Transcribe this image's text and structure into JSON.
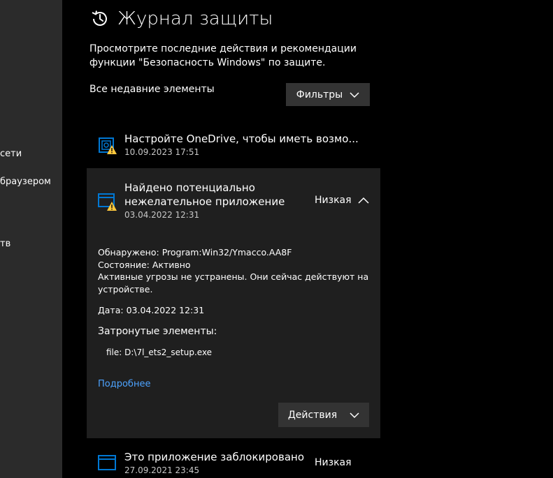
{
  "sidebar": {
    "items": [
      {
        "label": "сети"
      },
      {
        "label": "браузером"
      },
      {
        "label": "тв"
      }
    ]
  },
  "header": {
    "title": "Журнал защиты",
    "subtitle": "Просмотрите последние действия и рекомендации функции \"Безопасность Windows\" по защите.",
    "icon": "history-icon"
  },
  "toolbar": {
    "section_label": "Все недавние элементы",
    "filters_label": "Фильтры"
  },
  "entries": [
    {
      "title": "Настройте OneDrive, чтобы иметь возмо...",
      "date": "10.09.2023 17:51",
      "icon": "onedrive-warning-icon"
    },
    {
      "title_line1": "Найдено потенциально",
      "title_line2": "нежелательное приложение",
      "date": "03.04.2022 12:31",
      "severity": "Низкая",
      "icon": "app-warning-icon",
      "details": {
        "detected_label": "Обнаружено:",
        "detected_value": "Program:Win32/Ymacco.AA8F",
        "status_label": "Состояние:",
        "status_value": "Активно",
        "message_line1": "Активные угрозы не устранены. Они сейчас действуют на",
        "message_line2": "устройстве.",
        "date_label": "Дата:",
        "date_value": "03.04.2022 12:31",
        "affected_heading": "Затронутые элементы:",
        "file": "file: D:\\7l_ets2_setup.exe",
        "link": "Подробнее",
        "actions_label": "Действия"
      }
    },
    {
      "title": "Это приложение заблокировано",
      "date": "27.09.2021 23:45",
      "severity": "Низкая",
      "icon": "app-window-icon"
    }
  ],
  "colors": {
    "sidebar_bg": "#2b2b2b",
    "main_bg": "#000000",
    "expanded_bg": "#1f1f1f",
    "button_bg": "#333333",
    "accent_blue": "#0078d4",
    "link_blue": "#4da3ff",
    "warning_yellow": "#ffc83d"
  }
}
